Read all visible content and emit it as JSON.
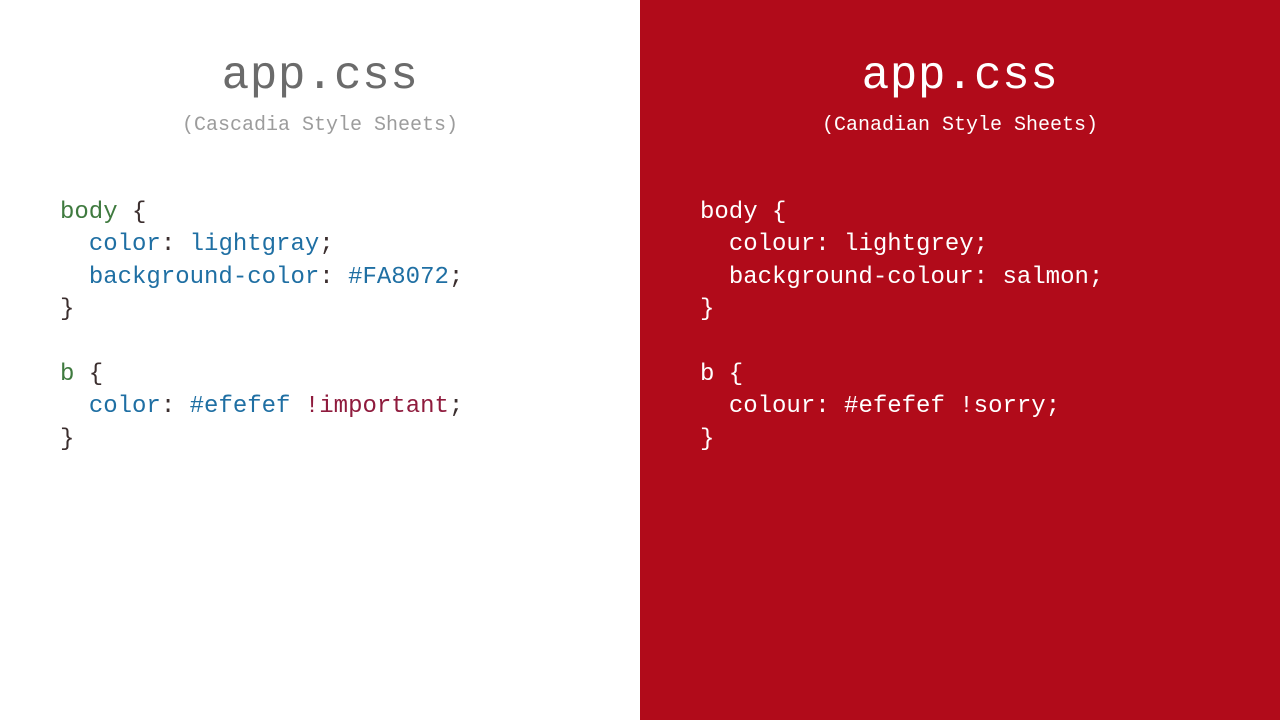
{
  "left": {
    "title": "app.css",
    "subtitle": "(Cascadia Style Sheets)",
    "code": {
      "sel1": "body",
      "brace_open1": " {",
      "indent": "  ",
      "prop1": "color",
      "val1": "lightgray",
      "prop2": "background-color",
      "val2": "#FA8072",
      "brace_close1": "}",
      "sel2": "b",
      "brace_open2": " {",
      "prop3": "color",
      "val3": "#efefef",
      "imp": " !important",
      "brace_close2": "}"
    }
  },
  "right": {
    "title": "app.css",
    "subtitle": "(Canadian Style Sheets)",
    "code": {
      "sel1": "body",
      "brace_open1": " {",
      "indent": "  ",
      "prop1": "colour",
      "val1": "lightgrey",
      "prop2": "background-colour",
      "val2": "salmon",
      "brace_close1": "}",
      "sel2": "b",
      "brace_open2": " {",
      "prop3": "colour",
      "val3": "#efefef",
      "imp": " !sorry",
      "brace_close2": "}"
    }
  },
  "sym": {
    "colon": ":",
    "space": " ",
    "semi": ";",
    "blank": ""
  }
}
